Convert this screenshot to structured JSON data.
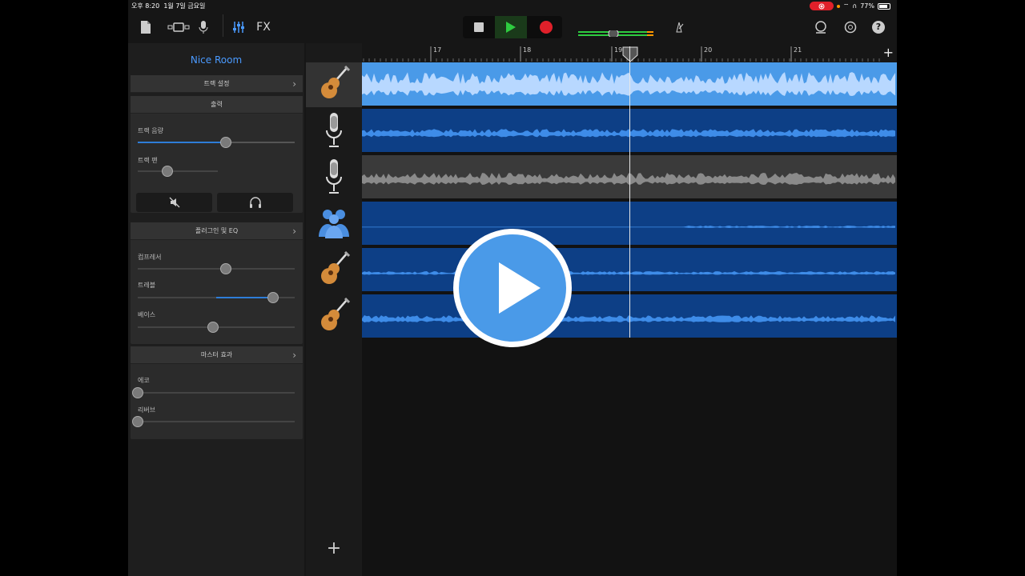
{
  "status": {
    "time": "오후 8:20",
    "date": "1월 7일 금요일",
    "battery": "77%"
  },
  "toolbar": {
    "fx_label": "FX"
  },
  "sidebar": {
    "room_name": "Nice Room",
    "track_settings": {
      "title": "트랙 설정"
    },
    "output": {
      "title": "출력",
      "track_volume_label": "트랙 음량",
      "track_volume": 0.56,
      "track_pan_label": "트랙 팬",
      "track_pan": 0.37
    },
    "plugins": {
      "title": "플러그인 및 EQ",
      "compressor_label": "컴프레서",
      "compressor": 0.56,
      "treble_label": "트레블",
      "treble": 0.86,
      "bass_label": "베이스",
      "bass": 0.48
    },
    "master": {
      "title": "마스터 효과",
      "echo_label": "에코",
      "echo": 0.0,
      "reverb_label": "리버브",
      "reverb": 0.0
    }
  },
  "ruler": {
    "bars": [
      "17",
      "18",
      "19",
      "20",
      "21"
    ]
  },
  "tracks": [
    {
      "icon": "acoustic-guitar-icon",
      "selected": true,
      "color": "#4a9ae8",
      "wave": "#b8d8ff"
    },
    {
      "icon": "microphone-icon",
      "selected": false,
      "color": "#0d3f86",
      "wave": "#3e8ce8"
    },
    {
      "icon": "microphone-icon",
      "selected": false,
      "color": "#3a3a3a",
      "wave": "#8a8a8a"
    },
    {
      "icon": "drummer-icon",
      "selected": false,
      "color": "#0d3f86",
      "wave": "#3e8ce8"
    },
    {
      "icon": "acoustic-guitar-icon",
      "selected": false,
      "color": "#0d3f86",
      "wave": "#3e8ce8"
    },
    {
      "icon": "acoustic-guitar-icon",
      "selected": false,
      "color": "#0d3f86",
      "wave": "#3e8ce8"
    }
  ],
  "colors": {
    "accent": "#4a9aff",
    "record": "#e0202a",
    "play": "#2ecc40"
  }
}
